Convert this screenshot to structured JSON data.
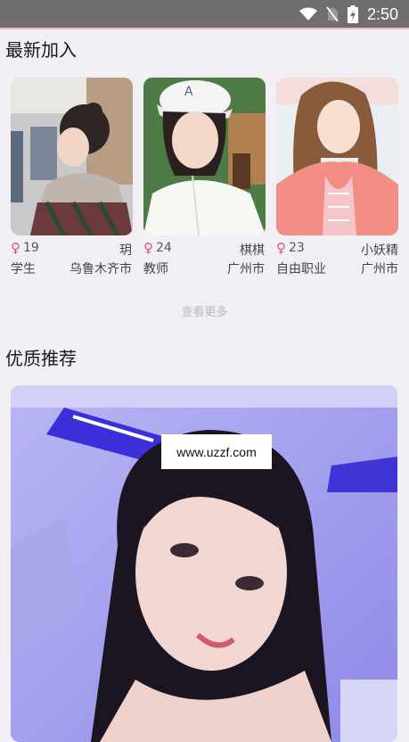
{
  "status_bar": {
    "time": "2:50"
  },
  "sections": {
    "new_join_title": "最新加入",
    "recommend_title": "优质推荐",
    "see_more": "查看更多"
  },
  "new_members": [
    {
      "age": "19",
      "name": "玥",
      "job": "学生",
      "city": "乌鲁木齐市"
    },
    {
      "age": "24",
      "name": "棋棋",
      "job": "教师",
      "city": "广州市"
    },
    {
      "age": "23",
      "name": "小妖精",
      "job": "自由职业",
      "city": "广州市"
    }
  ],
  "watermark": "www.uzzf.com",
  "colors": {
    "accent_pink": "#e2507a",
    "status_bar": "#6f6f6f",
    "background": "#f1eff4"
  }
}
